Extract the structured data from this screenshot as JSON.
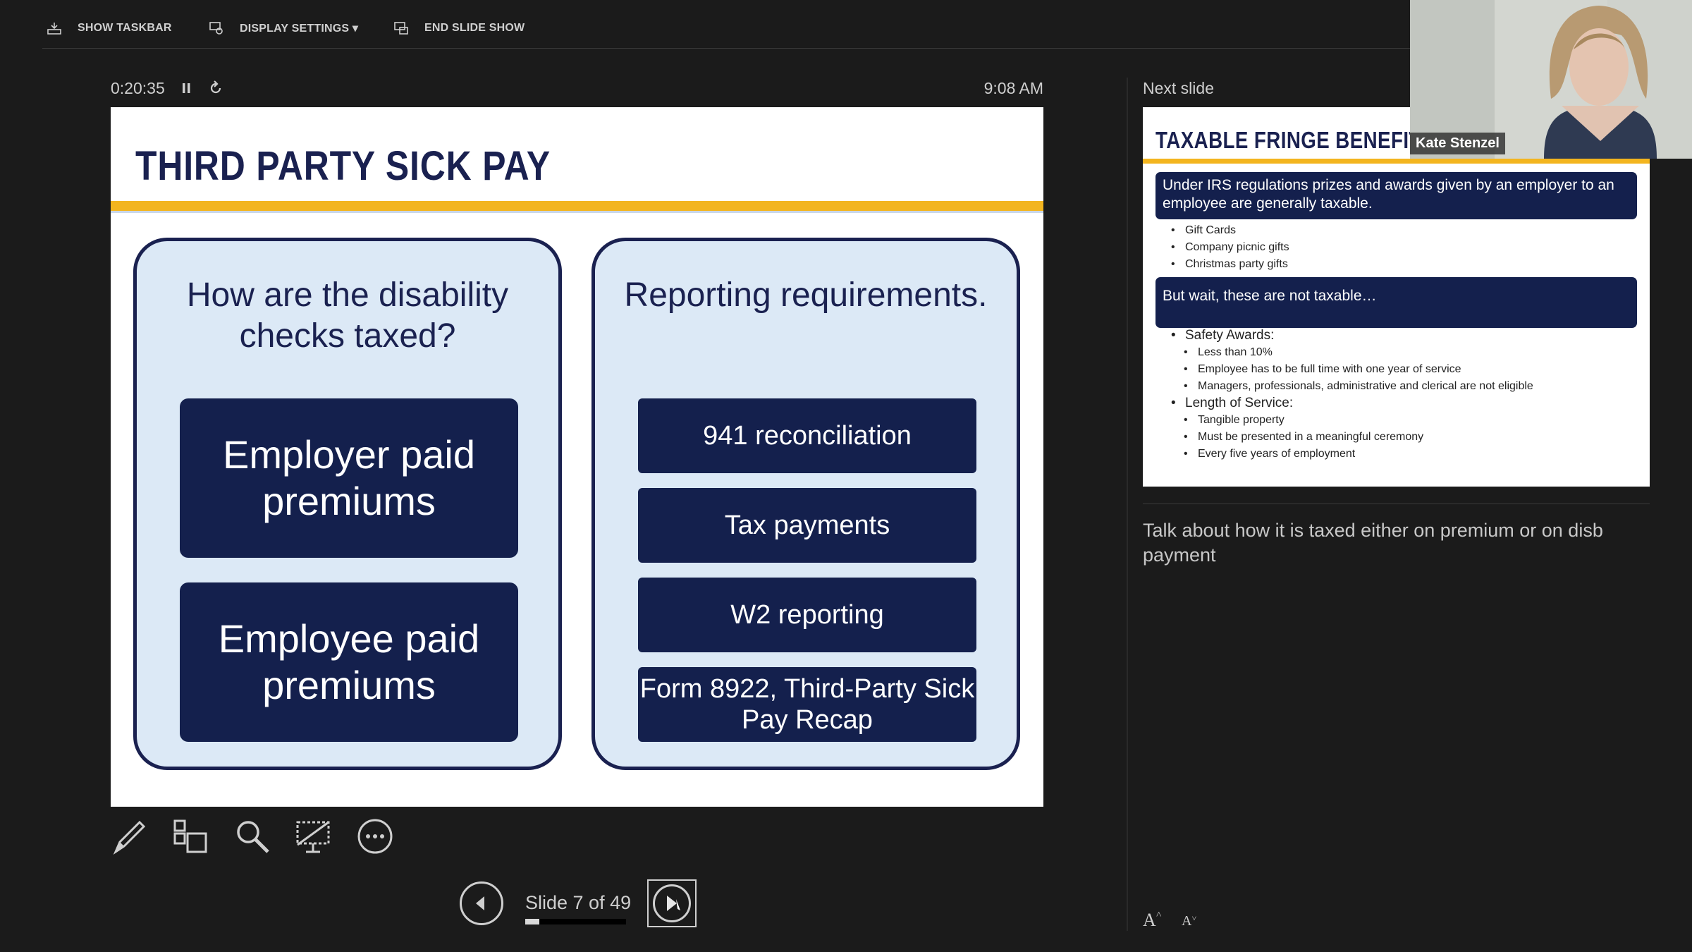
{
  "toolbar": {
    "show_taskbar": "SHOW TASKBAR",
    "display_settings": "DISPLAY SETTINGS ▾",
    "end_slide_show": "END SLIDE SHOW"
  },
  "presenter": {
    "elapsed": "0:20:35",
    "clock": "9:08 AM"
  },
  "current_slide": {
    "title": "THIRD PARTY SICK PAY",
    "left_panel": {
      "heading": "How are the disability checks taxed?",
      "boxes": [
        "Employer paid premiums",
        "Employee paid premiums"
      ]
    },
    "right_panel": {
      "heading": "Reporting requirements.",
      "boxes": [
        "941 reconciliation",
        "Tax payments",
        "W2 reporting",
        "Form 8922, Third-Party Sick Pay Recap"
      ]
    }
  },
  "navigation": {
    "label": "Slide 7 of 49",
    "progress_fraction": 0.143
  },
  "next_slide": {
    "label": "Next slide",
    "title": "TAXABLE FRINGE BENEFITS",
    "box1": "Under IRS regulations prizes and awards given by an employer to an employee are generally taxable.",
    "list1": [
      "Gift Cards",
      "Company picnic gifts",
      "Christmas party gifts"
    ],
    "box2": "But wait, these are not taxable…",
    "safety_heading": "Safety Awards:",
    "safety_items": [
      "Less than 10%",
      "Employee has to be full time with one year of service",
      "Managers, professionals, administrative and clerical are not eligible"
    ],
    "length_heading": "Length of Service:",
    "length_items": [
      "Tangible property",
      "Must be presented in a meaningful ceremony",
      "Every five years of employment"
    ]
  },
  "notes": "Talk about how it is taxed either on premium or on disb payment",
  "font_controls": {
    "increase": "A",
    "decrease": "A"
  },
  "webcam": {
    "name": "Kate Stenzel"
  },
  "icons": [
    "taskbar-icon",
    "display-settings-icon",
    "end-show-icon",
    "pause-icon",
    "reset-icon",
    "pen-icon",
    "slides-grid-icon",
    "zoom-icon",
    "screen-icon",
    "more-icon",
    "prev-icon",
    "next-icon"
  ],
  "colors": {
    "slide_navy": "#14204d",
    "slide_gold": "#f3b51f",
    "panel_fill": "#dce9f6",
    "background": "#1b1b1b"
  }
}
